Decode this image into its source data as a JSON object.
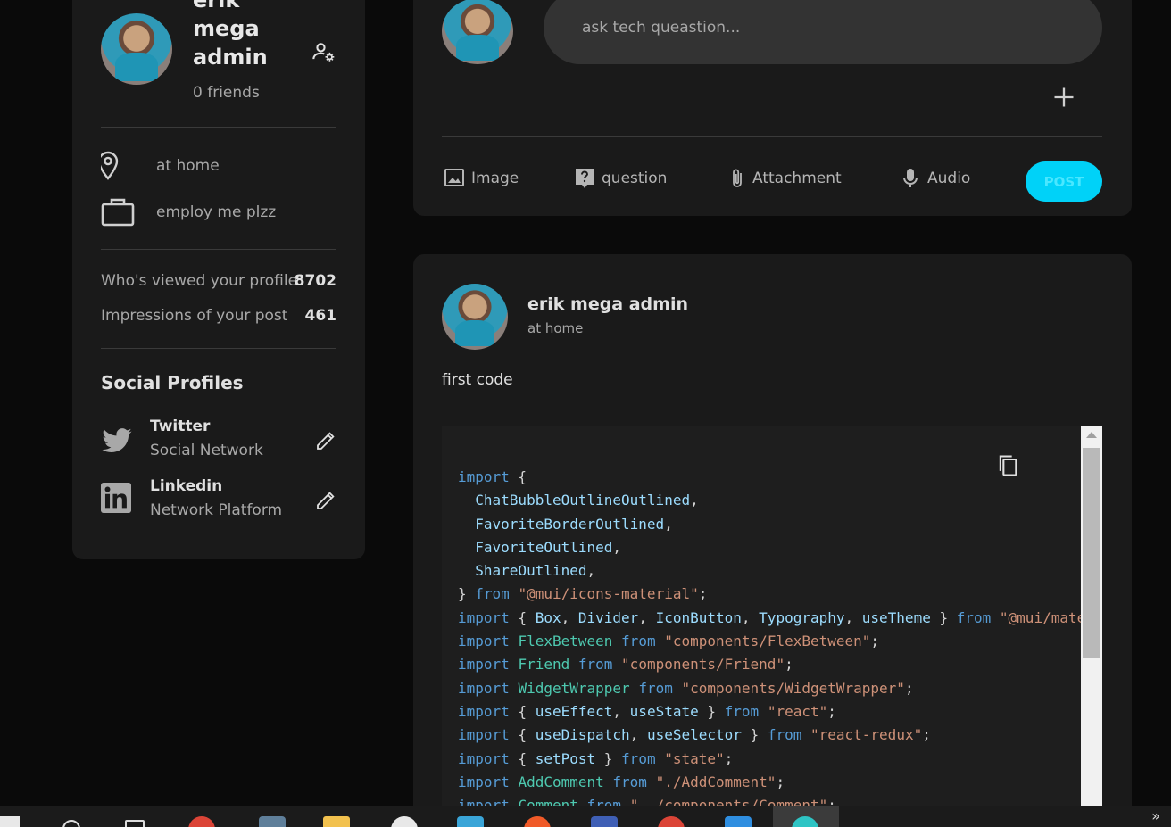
{
  "profile": {
    "name": "erik mega admin",
    "friends": "0 friends",
    "location": "at home",
    "occupation": "employ me plzz",
    "stats": [
      {
        "label": "Who's viewed your profile",
        "value": "8702"
      },
      {
        "label": "Impressions of your post",
        "value": "461"
      }
    ],
    "social_title": "Social Profiles",
    "social": [
      {
        "name": "Twitter",
        "sub": "Social Network"
      },
      {
        "name": "Linkedin",
        "sub": "Network Platform"
      }
    ]
  },
  "composer": {
    "placeholder": "ask tech queastion...",
    "tools": [
      "Image",
      "question",
      "Attachment",
      "Audio"
    ],
    "post_label": "POST"
  },
  "post": {
    "author": "erik mega admin",
    "location": "at home",
    "text": "first code",
    "code_lines": [
      "import {",
      "  ChatBubbleOutlineOutlined,",
      "  FavoriteBorderOutlined,",
      "  FavoriteOutlined,",
      "  ShareOutlined,",
      "} from \"@mui/icons-material\";",
      "import { Box, Divider, IconButton, Typography, useTheme } from \"@mui/material\";",
      "import FlexBetween from \"components/FlexBetween\";",
      "import Friend from \"components/Friend\";",
      "import WidgetWrapper from \"components/WidgetWrapper\";",
      "import { useEffect, useState } from \"react\";",
      "import { useDispatch, useSelector } from \"react-redux\";",
      "import { setPost } from \"state\";",
      "import AddComment from \"./AddComment\";",
      "import Comment from \"../components/Comment\";"
    ]
  },
  "colors": {
    "accent": "#00d2f8",
    "card": "#1a1a1a",
    "background": "#0a0a0a"
  }
}
